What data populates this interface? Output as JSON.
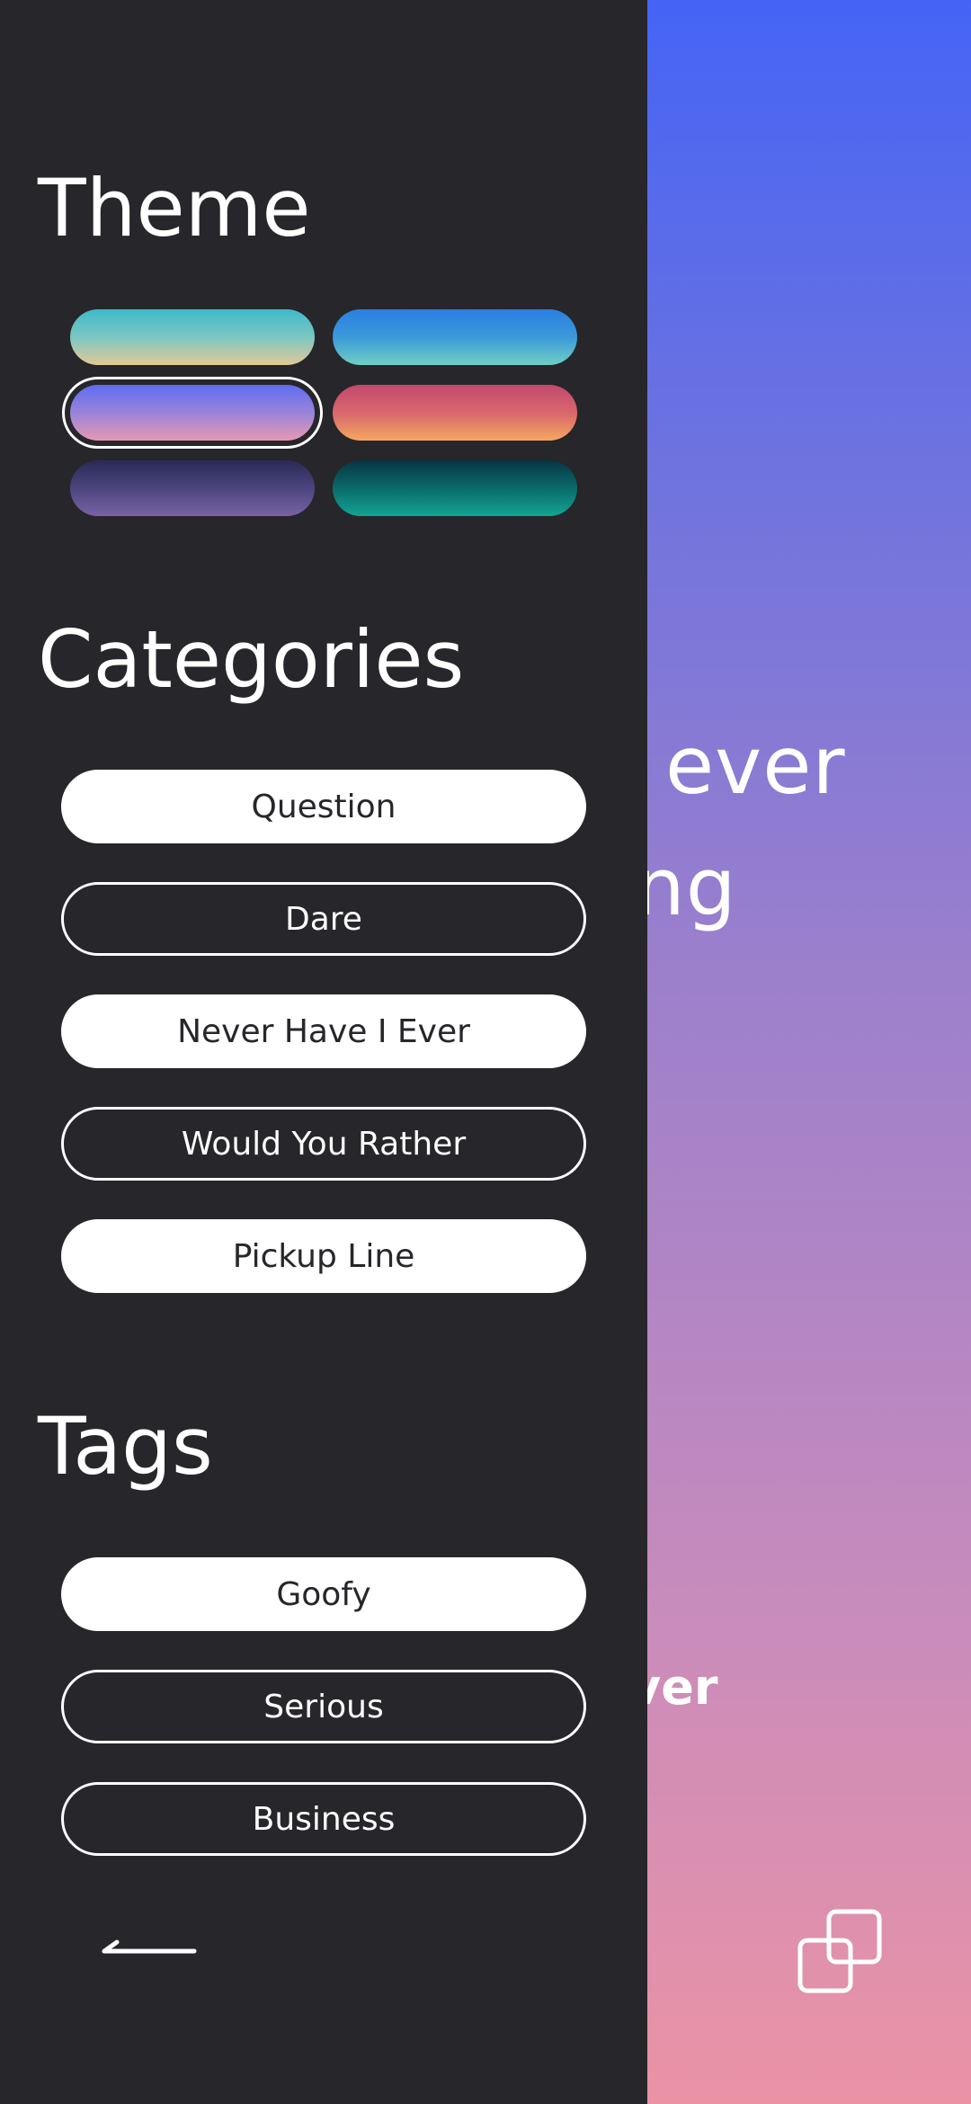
{
  "background": {
    "line1": "ever",
    "line2": "ng",
    "footer": "ver",
    "copy_icon": "copy-icon"
  },
  "drawer": {
    "theme": {
      "title": "Theme",
      "swatches": [
        {
          "name": "teal-sand",
          "selected": false
        },
        {
          "name": "ocean",
          "selected": false
        },
        {
          "name": "violet-pink",
          "selected": true
        },
        {
          "name": "sunset",
          "selected": false
        },
        {
          "name": "night-purple",
          "selected": false
        },
        {
          "name": "deep-teal",
          "selected": false
        }
      ]
    },
    "categories": {
      "title": "Categories",
      "items": [
        {
          "label": "Question",
          "active": true
        },
        {
          "label": "Dare",
          "active": false
        },
        {
          "label": "Never Have I Ever",
          "active": true
        },
        {
          "label": "Would You Rather",
          "active": false
        },
        {
          "label": "Pickup Line",
          "active": true
        }
      ]
    },
    "tags": {
      "title": "Tags",
      "items": [
        {
          "label": "Goofy",
          "active": true
        },
        {
          "label": "Serious",
          "active": false
        },
        {
          "label": "Business",
          "active": false
        }
      ]
    },
    "back_icon": "back-arrow-icon"
  },
  "colors": {
    "drawer_bg": "#27262a",
    "gradient_top": "#4564f5",
    "gradient_bottom": "#eb93a5",
    "pill_active_bg": "#ffffff",
    "pill_inactive_bg": "#27262a"
  }
}
